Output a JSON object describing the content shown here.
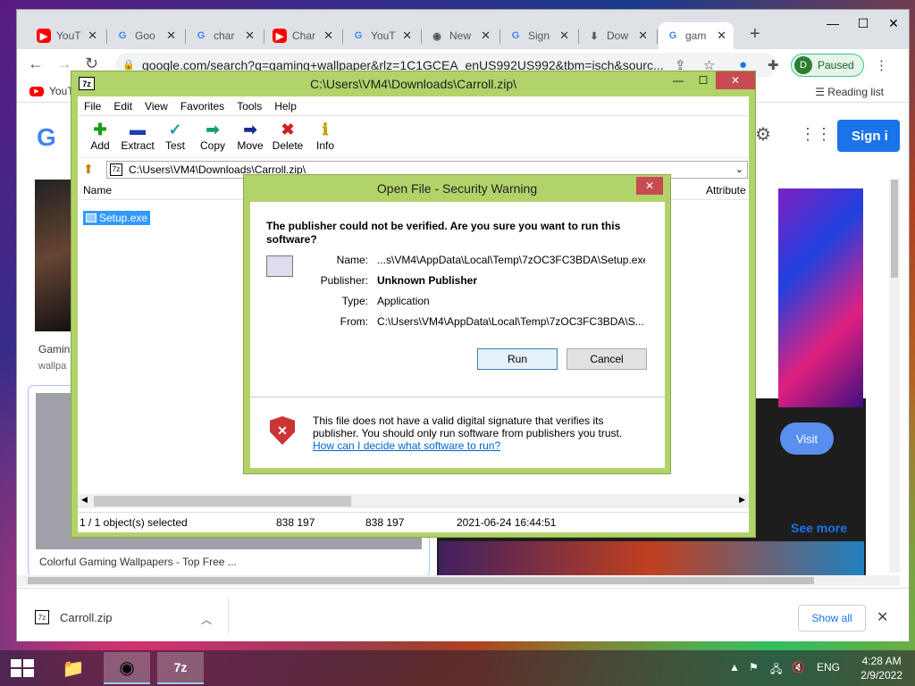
{
  "chrome": {
    "tabs": [
      {
        "icon": "youtube-icon",
        "title": "YouT"
      },
      {
        "icon": "google-icon",
        "title": "Goo"
      },
      {
        "icon": "google-icon",
        "title": "char"
      },
      {
        "icon": "youtube-icon",
        "title": "Char"
      },
      {
        "icon": "google-icon",
        "title": "YouT"
      },
      {
        "icon": "chrome-icon",
        "title": "New"
      },
      {
        "icon": "google-icon",
        "title": "Sign"
      },
      {
        "icon": "download-icon",
        "title": "Dow"
      },
      {
        "icon": "google-icon",
        "title": "gam"
      }
    ],
    "url": "google.com/search?q=gaming+wallpaper&rlz=1C1GCEA_enUS992US992&tbm=isch&sourc...",
    "profile_initial": "D",
    "profile_status": "Paused",
    "bookmark_label": "YouT",
    "reading_list": "Reading list",
    "sign_in": "Sign i",
    "result1_caption": "Gamin",
    "result1_source": "wallpa",
    "card_caption": "Colorful Gaming Wallpapers - Top Free ...",
    "visit": "Visit",
    "see_more": "See more"
  },
  "downloads": {
    "file": "Carroll.zip",
    "show_all": "Show all"
  },
  "sevenzip": {
    "title": "C:\\Users\\VM4\\Downloads\\Carroll.zip\\",
    "menu": [
      "File",
      "Edit",
      "View",
      "Favorites",
      "Tools",
      "Help"
    ],
    "tools": [
      {
        "label": "Add",
        "icon": "add-icon",
        "glyph": "✚",
        "color": "#1a9c1a"
      },
      {
        "label": "Extract",
        "icon": "extract-icon",
        "glyph": "▬",
        "color": "#1a3fb0"
      },
      {
        "label": "Test",
        "icon": "test-icon",
        "glyph": "✓",
        "color": "#1aa0a0"
      },
      {
        "label": "Copy",
        "icon": "copy-icon",
        "glyph": "➡",
        "color": "#1a9c70"
      },
      {
        "label": "Move",
        "icon": "move-icon",
        "glyph": "➡",
        "color": "#1a2a90"
      },
      {
        "label": "Delete",
        "icon": "delete-icon",
        "glyph": "✖",
        "color": "#d02020"
      },
      {
        "label": "Info",
        "icon": "info-icon",
        "glyph": "ℹ",
        "color": "#c0a000"
      }
    ],
    "address": "C:\\Users\\VM4\\Downloads\\Carroll.zip\\",
    "col_name": "Name",
    "col_attributes": "Attribute",
    "file": "Setup.exe",
    "status": {
      "selected": "1 / 1 object(s) selected",
      "size": "838 197",
      "packed": "838 197",
      "modified": "2021-06-24 16:44:51"
    }
  },
  "dialog": {
    "title": "Open File - Security Warning",
    "question": "The publisher could not be verified.  Are you sure you want to run this software?",
    "name_label": "Name:",
    "name_value": "...s\\VM4\\AppData\\Local\\Temp\\7zOC3FC3BDA\\Setup.exe",
    "publisher_label": "Publisher:",
    "publisher_value": "Unknown Publisher",
    "type_label": "Type:",
    "type_value": "Application",
    "from_label": "From:",
    "from_value": "C:\\Users\\VM4\\AppData\\Local\\Temp\\7zOC3FC3BDA\\S...",
    "run": "Run",
    "cancel": "Cancel",
    "warning": "This file does not have a valid digital signature that verifies its publisher.  You should only run software from publishers you trust.",
    "link": "How can I decide what software to run?"
  },
  "taskbar": {
    "lang": "ENG",
    "time": "4:28 AM",
    "date": "2/9/2022"
  }
}
